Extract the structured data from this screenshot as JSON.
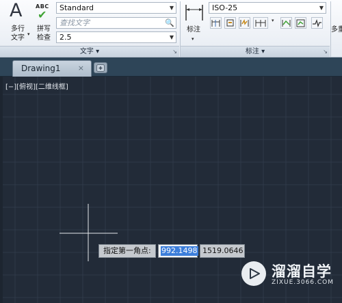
{
  "ribbon": {
    "text_panel": {
      "title": "文字",
      "multiline_text_label": [
        "多行",
        "文字"
      ],
      "spellcheck_abc": "ABC",
      "spellcheck_label": [
        "拼写",
        "检查"
      ],
      "text_style_value": "Standard",
      "find_text_placeholder": "查找文字",
      "text_height_value": "2.5"
    },
    "dimension_panel": {
      "title": "标注",
      "dimension_button_label": "标注",
      "dim_style_value": "ISO-25"
    },
    "multileader_label": "多重"
  },
  "tabs": {
    "active_tab_label": "Drawing1",
    "close_glyph": "×"
  },
  "canvas": {
    "viewport_label": "[−][俯视][二维线框]",
    "background_color": "#222b38",
    "grid_color": "#2f3a49"
  },
  "dynamic_input": {
    "prompt": "指定第一角点:",
    "x_value": "992.1498",
    "y_value": "1519.0646"
  },
  "watermark": {
    "title": "溜溜自学",
    "url": "ZIXUE.3066.COM"
  }
}
